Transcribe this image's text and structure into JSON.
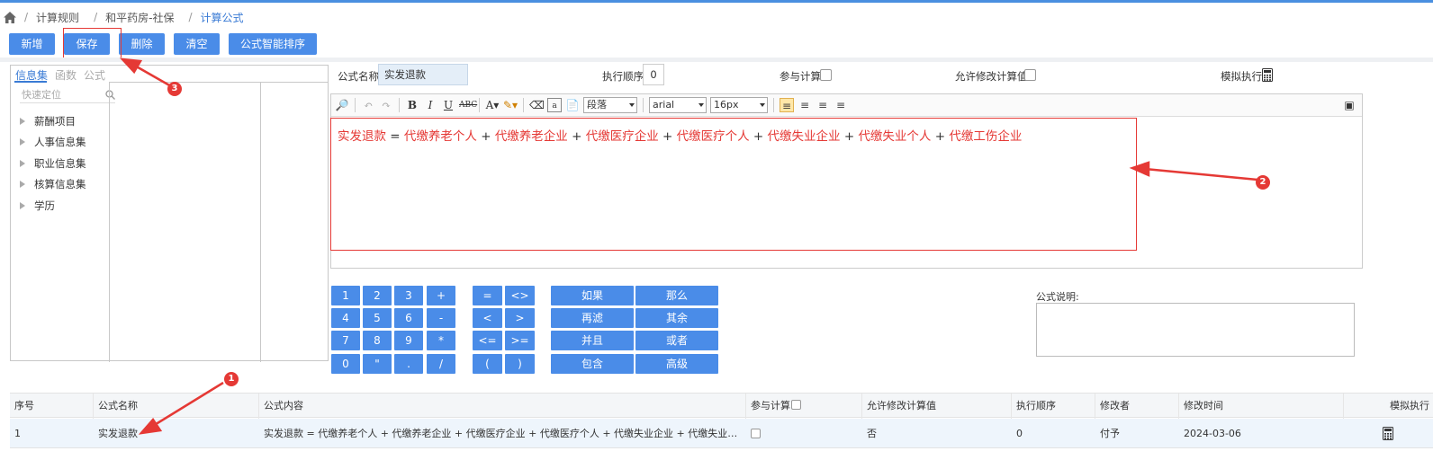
{
  "breadcrumb": {
    "items": [
      "计算规则",
      "和平药房-社保",
      "计算公式"
    ]
  },
  "toolbar": {
    "add": "新增",
    "save": "保存",
    "delete": "删除",
    "clear": "清空",
    "sort": "公式智能排序"
  },
  "left_panel": {
    "tabs": [
      "信息集",
      "函数",
      "公式"
    ],
    "search_placeholder": "快速定位",
    "tree": [
      "薪酬项目",
      "人事信息集",
      "职业信息集",
      "核算信息集",
      "学历"
    ]
  },
  "form": {
    "name_label": "公式名称",
    "name_value": "实发退款",
    "order_label": "执行顺序",
    "order_value": "0",
    "participate_label": "参与计算",
    "allow_label": "允许修改计算值",
    "simulate_label": "模拟执行"
  },
  "editor": {
    "toolbar": {
      "paragraph": "段落",
      "font": "arial",
      "size": "16px"
    },
    "formula": {
      "lhs": "实发退款",
      "eq": "=",
      "plus": "+",
      "terms": [
        "代缴养老个人",
        "代缴养老企业",
        "代缴医疗企业",
        "代缴医疗个人",
        "代缴失业企业",
        "代缴失业个人",
        "代缴工伤企业"
      ]
    }
  },
  "keypad": {
    "digits": [
      "1",
      "2",
      "3",
      "+",
      "4",
      "5",
      "6",
      "-",
      "7",
      "8",
      "9",
      "*",
      "0",
      "\"",
      ".",
      "/"
    ],
    "compare": [
      "=",
      "<>",
      "<",
      ">",
      "<=",
      ">=",
      "(",
      ")"
    ],
    "logic": [
      "如果",
      "那么",
      "再滤",
      "其余",
      "并且",
      "或者",
      "包含",
      "高级"
    ]
  },
  "description_label": "公式说明:",
  "table": {
    "headers": [
      "序号",
      "公式名称",
      "公式内容",
      "参与计算",
      "允许修改计算值",
      "执行顺序",
      "修改者",
      "修改时间",
      "模拟执行"
    ],
    "rows": [
      {
        "index": "1",
        "name": "实发退款",
        "content": "实发退款 = 代缴养老个人 + 代缴养老企业 + 代缴医疗企业 + 代缴医疗个人 + 代缴失业企业 + 代缴失业个人 + 代缴...",
        "allow": "否",
        "order": "0",
        "modifier": "付予",
        "time": "2024-03-06"
      }
    ]
  },
  "annotations": [
    "1",
    "2",
    "3"
  ],
  "colors": {
    "accent": "#4a8ce8",
    "annotation": "#e53935"
  }
}
